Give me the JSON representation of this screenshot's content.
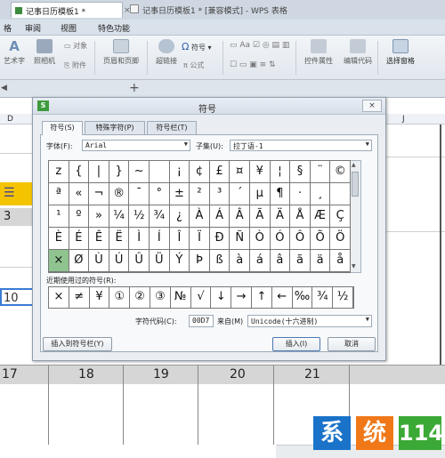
{
  "window": {
    "title": "记事日历模板1 * [兼容模式] - WPS 表格"
  },
  "menu": {
    "items": [
      "格",
      "审阅",
      "视图",
      "特色功能"
    ]
  },
  "ribbon": {
    "buttons": [
      "艺术字",
      "照相机",
      "对象",
      "附件",
      "页眉和页脚",
      "超链接",
      "符号",
      "公式",
      "控件属性",
      "编辑代码",
      "选择窗格"
    ]
  },
  "doc_tab": {
    "name": "记事日历模板1 *",
    "close": "×",
    "new": "+",
    "prev": "◀"
  },
  "sheet": {
    "col_left": "D",
    "col_right": "J",
    "left_numbers": [
      "3",
      "10"
    ],
    "bottom_numbers": [
      "17",
      "18",
      "19",
      "20",
      "21"
    ]
  },
  "dialog": {
    "title": "符号",
    "close": "×",
    "logo": "S",
    "tabs": [
      "符号(S)",
      "特殊字符(P)",
      "符号栏(T)"
    ],
    "font_label": "字体(F):",
    "font_value": "Arial",
    "subset_label": "子集(U):",
    "subset_value": "拉丁语-1",
    "grid": [
      [
        "z",
        "{",
        "|",
        "}",
        "~",
        "",
        "¡",
        "¢",
        "£",
        "¤",
        "¥",
        "¦",
        "§",
        "¨",
        "©"
      ],
      [
        "ª",
        "«",
        "¬",
        "®",
        "¯",
        "°",
        "±",
        "²",
        "³",
        "´",
        "µ",
        "¶",
        "·",
        "¸",
        ""
      ],
      [
        "¹",
        "º",
        "»",
        "¼",
        "½",
        "¾",
        "¿",
        "À",
        "Á",
        "Â",
        "Ã",
        "Ä",
        "Å",
        "Æ",
        "Ç"
      ],
      [
        "È",
        "É",
        "Ê",
        "Ë",
        "Ì",
        "Í",
        "Î",
        "Ï",
        "Ð",
        "Ñ",
        "Ò",
        "Ó",
        "Ô",
        "Õ",
        "Ö"
      ],
      [
        "×",
        "Ø",
        "Ù",
        "Ú",
        "Û",
        "Ü",
        "Ý",
        "Þ",
        "ß",
        "à",
        "á",
        "â",
        "ã",
        "ä",
        "å"
      ]
    ],
    "recent_label": "近期使用过的符号(R):",
    "recent": [
      "×",
      "≠",
      "¥",
      "①",
      "②",
      "③",
      "№",
      "√",
      "↓",
      "→",
      "↑",
      "←",
      "‰",
      "¾",
      "½"
    ],
    "code_label": "字符代码(C):",
    "code_value": "00D7",
    "from_label": "来自(M)",
    "from_value": "Unicode(十六进制)",
    "insert_bar": "插入到符号栏(Y)",
    "insert": "插入(I)",
    "cancel": "取消"
  },
  "watermark": {
    "chars": [
      "系",
      "统",
      "114"
    ]
  },
  "colors": {
    "selected_cell": "#8fc38f",
    "sheet_yellow": "#f5c400",
    "wm_blue": "#1a73c9",
    "wm_orange": "#f07818",
    "wm_green": "#3ba935"
  }
}
